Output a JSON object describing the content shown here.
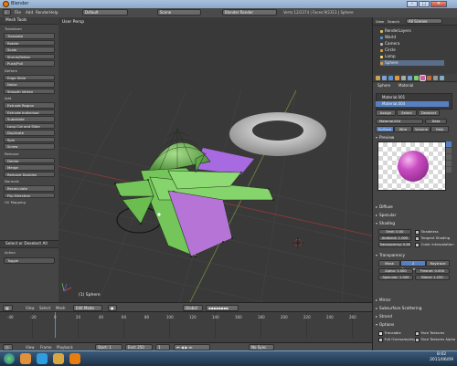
{
  "window": {
    "title": "Blender",
    "min": "–",
    "max": "□",
    "close": "✕"
  },
  "header": {
    "menus": [
      "File",
      "Add",
      "Render",
      "Help"
    ],
    "layout": "Default",
    "scene": "Scene",
    "engine": "Blender Render",
    "stats": "Verts:12/2374 | Faces:9/2313 | Sphere"
  },
  "toolshelf": {
    "title": "Mesh Tools",
    "groups": [
      {
        "name": "Transform",
        "items": [
          "Translate",
          "Rotate",
          "Scale",
          "Shrink/Fatten",
          "Push/Pull"
        ]
      },
      {
        "name": "Deform",
        "items": [
          "Edge Slide",
          "Noise",
          "Smooth Vertex"
        ]
      },
      {
        "name": "Add",
        "items": [
          "Extrude Region",
          "Extrude Individual",
          "Subdivide",
          "Loop Cut and Slide",
          "Duplicate",
          "Spin",
          "Screw"
        ]
      },
      {
        "name": "Remove",
        "items": [
          "Delete",
          "Merge",
          "Remove Doubles"
        ]
      },
      {
        "name": "Normals",
        "items": [
          "Recalculate",
          "Flip Direction"
        ]
      },
      {
        "name": "UV Mapping",
        "items": []
      }
    ],
    "operator": {
      "title": "Select or Deselect All",
      "action_label": "Action",
      "action_value": "Toggle"
    }
  },
  "viewport": {
    "label": "User Persp",
    "object_label": "(1) Sphere"
  },
  "view3d_header": {
    "items": [
      "View",
      "Select",
      "Mesh"
    ],
    "mode": "Edit Mode",
    "pivot": "Global"
  },
  "timeline": {
    "ticks": [
      "-40",
      "-20",
      "0",
      "20",
      "40",
      "60",
      "80",
      "100",
      "120",
      "140",
      "160",
      "180",
      "200",
      "220",
      "240",
      "260"
    ],
    "menus": [
      "View",
      "Frame",
      "Playback"
    ],
    "start": "Start: 1",
    "end": "End: 250",
    "current": "1",
    "sync": "No Sync"
  },
  "outliner": {
    "items": [
      "RenderLayers",
      "World",
      "Camera",
      "Circle",
      "Lamp",
      "Sphere"
    ],
    "header_items": [
      "View",
      "Search",
      "All Scenes"
    ]
  },
  "properties": {
    "context": [
      "Sphere",
      "Material"
    ],
    "slots": [
      "Material.001",
      "Material.004"
    ],
    "assign": "Assign",
    "select": "Select",
    "deselect": "Deselect",
    "material_name": "Material.004",
    "data_label": "Data",
    "tabs": [
      "Surface",
      "Wire",
      "Volume",
      "Halo"
    ],
    "preview_label": "Preview",
    "diffuse": "Diffuse",
    "specular": "Specular",
    "shading": "Shading",
    "emit": "Emit: 0.00",
    "ambient": "Ambient: 1.000",
    "translucency": "Translucency: 0.000",
    "shadeless": "Shadeless",
    "tangent": "Tangent Shading",
    "cubic": "Cubic Interpolation",
    "transparency": "Transparency",
    "tmodes": [
      "Mask",
      "Z Transparency",
      "Raytrace"
    ],
    "alpha": "Alpha: 1.000",
    "fresnel": "Fresnel: 0.000",
    "specular_t": "Specular: 1.000",
    "blend": "Blend: 1.250",
    "mirror": "Mirror",
    "sss": "Subsurface Scattering",
    "strand": "Strand",
    "options": "Options",
    "traceable": "Traceable",
    "full_oversampling": "Full Oversampling",
    "face_textures": "Face Textures",
    "face_textures_alpha": "Face Textures Alpha"
  },
  "taskbar": {
    "time": "8:02",
    "date": "2011/06/09"
  },
  "colors": {
    "mesh_green": "#74c65a",
    "selection_purple": "#b574d6",
    "material_sphere": "#b23fb0"
  }
}
